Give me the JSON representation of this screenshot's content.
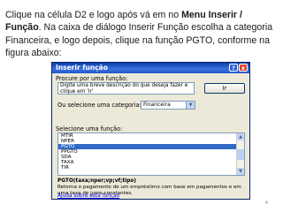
{
  "instruction": {
    "part1": "Clique na célula D2 e logo após vá em no ",
    "bold": "Menu Inserir / Função",
    "part2": ". Na caixa de diálogo Inserir Função escolha a categoria Financeira, e logo depois, clique na função PGTO, conforme na figura abaixo:"
  },
  "dialog": {
    "title": "Inserir função",
    "help_icon": "?",
    "close_icon": "x",
    "search_label": "Procure por uma função:",
    "search_value": "Digite uma breve descrição do que deseja fazer e clique em 'Ir'",
    "go_button": "Ir",
    "category_label": "Ou selecione uma categoria:",
    "category_value": "Financeira",
    "list_label": "Selecione uma função:",
    "functions": [
      "MTIR",
      "NPER",
      "PGTO",
      "PPGTO",
      "SDA",
      "TAXA",
      "TIR"
    ],
    "selected_index": 2,
    "syntax": "PGTO(taxa;nper;vp;vf;tipo)",
    "description": "Retorna o pagamento de um empréstimo com base em pagamentos e em uma taxa de juros constantes.",
    "help_link": "Ajuda sobre esta função"
  },
  "icons": {
    "close": "close-icon",
    "help": "help-icon",
    "dropdown": "chevron-down-icon"
  },
  "colors": {
    "titlebar": "#0a3fa8",
    "selection": "#316ac5",
    "dialog_bg": "#ece9d8"
  },
  "page_number": "4"
}
